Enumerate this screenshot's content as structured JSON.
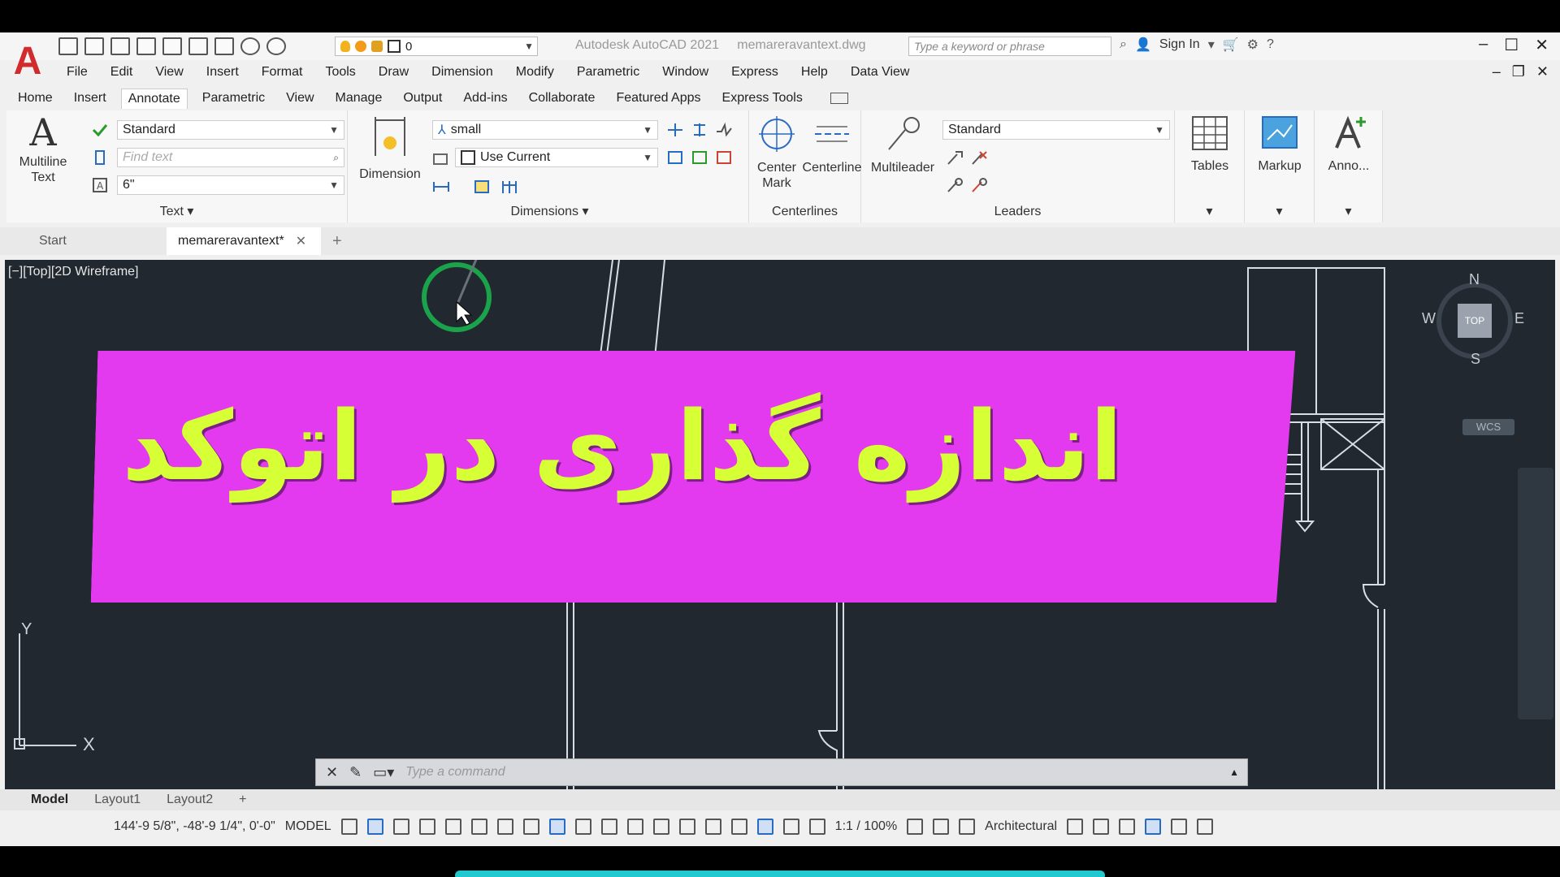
{
  "titlebar": {
    "app_title": "Autodesk AutoCAD 2021",
    "file_name": "memareravantext.dwg",
    "layer_value": "0",
    "search_placeholder": "Type a keyword or phrase",
    "sign_in": "Sign In"
  },
  "menu": [
    "File",
    "Edit",
    "View",
    "Insert",
    "Format",
    "Tools",
    "Draw",
    "Dimension",
    "Modify",
    "Parametric",
    "Window",
    "Express",
    "Help",
    "Data View"
  ],
  "ribbon_tabs": [
    "Home",
    "Insert",
    "Annotate",
    "Parametric",
    "View",
    "Manage",
    "Output",
    "Add-ins",
    "Collaborate",
    "Featured Apps",
    "Express Tools"
  ],
  "active_ribbon_tab": "Annotate",
  "text_panel": {
    "multiline_text": "Multiline Text",
    "text_style": "Standard",
    "find_placeholder": "Find text",
    "text_height": "6\"",
    "title": "Text"
  },
  "dimensions_panel": {
    "dimension": "Dimension",
    "dim_style": "small",
    "dim_layer": "Use Current",
    "title": "Dimensions"
  },
  "centerlines_panel": {
    "center_mark": "Center Mark",
    "centerline": "Centerline",
    "title": "Centerlines"
  },
  "leaders_panel": {
    "multileader": "Multileader",
    "leader_style": "Standard",
    "title": "Leaders"
  },
  "extra_buttons": {
    "tables": "Tables",
    "markup": "Markup",
    "anno": "Anno..."
  },
  "file_tabs": {
    "start": "Start",
    "doc": "memareravantext*"
  },
  "viewport": {
    "label": "[−][Top][2D Wireframe]",
    "viewcube_top": "TOP",
    "compass_n": "N",
    "compass_s": "S",
    "compass_e": "E",
    "compass_w": "W",
    "wcs": "WCS",
    "ucs_x": "X",
    "ucs_y": "Y"
  },
  "banner": {
    "text": "اندازه گذاری در اتوکد",
    "bg_color": "#e33af0",
    "text_color": "#d6ff35"
  },
  "command_line": {
    "placeholder": "Type a command"
  },
  "layout_tabs": [
    "Model",
    "Layout1",
    "Layout2"
  ],
  "status": {
    "coordinates": "144'-9 5/8\", -48'-9 1/4\", 0'-0\"",
    "model": "MODEL",
    "scale": "1:1 / 100%",
    "units": "Architectural"
  }
}
